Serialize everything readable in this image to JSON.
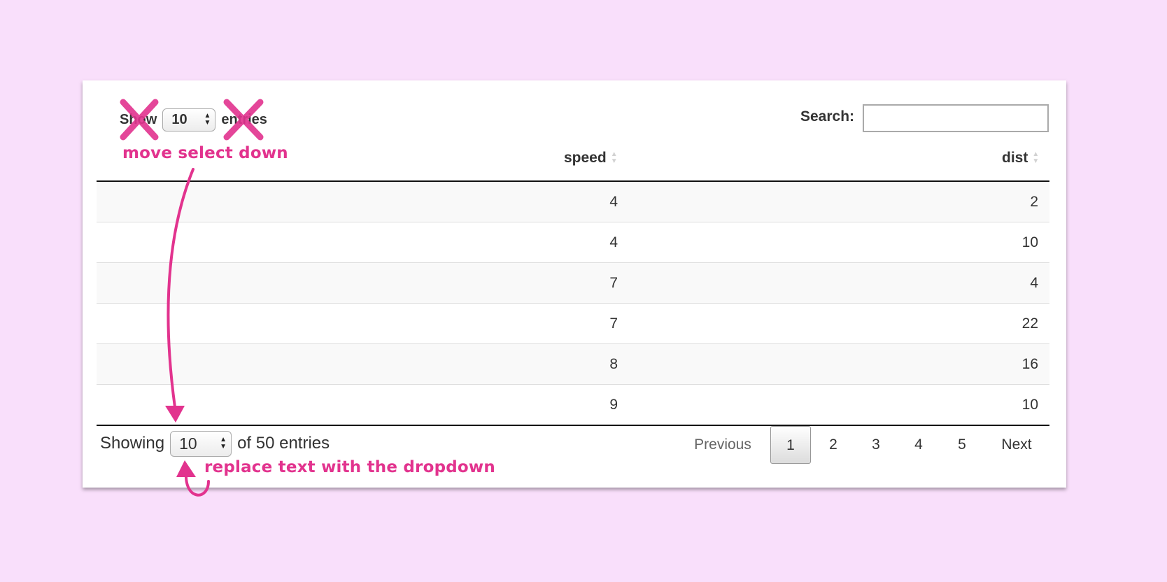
{
  "length_top": {
    "before": "Show",
    "value": "10",
    "after": "entries"
  },
  "search": {
    "label": "Search:",
    "value": "",
    "placeholder": ""
  },
  "table": {
    "columns": [
      "speed",
      "dist"
    ],
    "rows": [
      [
        "4",
        "2"
      ],
      [
        "4",
        "10"
      ],
      [
        "7",
        "4"
      ],
      [
        "7",
        "22"
      ],
      [
        "8",
        "16"
      ],
      [
        "9",
        "10"
      ]
    ]
  },
  "info": {
    "before": "Showing",
    "value": "10",
    "after": "of 50 entries"
  },
  "pagination": {
    "previous": "Previous",
    "pages": [
      "1",
      "2",
      "3",
      "4",
      "5"
    ],
    "current": "1",
    "next": "Next"
  },
  "annotations": {
    "top_note": "move select down",
    "bottom_note": "replace text with the dropdown",
    "color": "#e2338e"
  },
  "colors": {
    "background": "#f9dffb",
    "card": "#ffffff",
    "stripe": "#f9f9f9"
  }
}
